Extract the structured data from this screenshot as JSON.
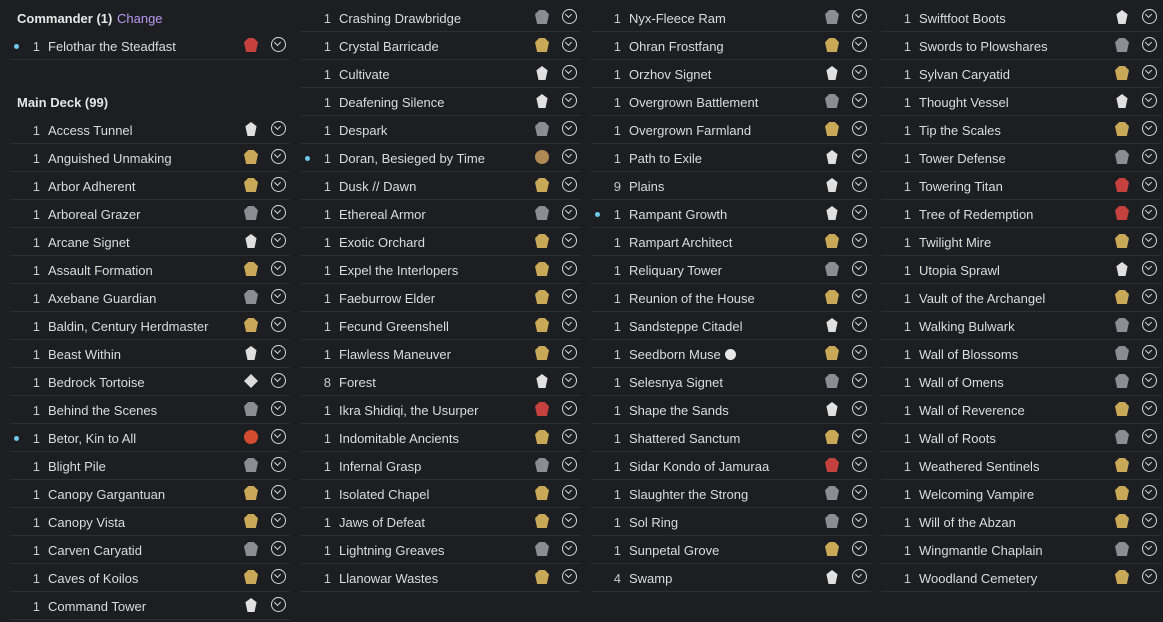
{
  "commander": {
    "header_label": "Commander (1)",
    "change_label": "Change",
    "cards": [
      {
        "qty": "1",
        "name": "Felothar the Steadfast",
        "set_icon": "red",
        "dot": true
      }
    ]
  },
  "main_deck": {
    "header_label": "Main Deck (99)"
  },
  "columns": [
    [
      {
        "qty": "1",
        "name": "Access Tunnel",
        "set_icon": "black"
      },
      {
        "qty": "1",
        "name": "Anguished Unmaking",
        "set_icon": "gold"
      },
      {
        "qty": "1",
        "name": "Arbor Adherent",
        "set_icon": "gold"
      },
      {
        "qty": "1",
        "name": "Arboreal Grazer",
        "set_icon": "silver"
      },
      {
        "qty": "1",
        "name": "Arcane Signet",
        "set_icon": "black"
      },
      {
        "qty": "1",
        "name": "Assault Formation",
        "set_icon": "gold"
      },
      {
        "qty": "1",
        "name": "Axebane Guardian",
        "set_icon": "silver"
      },
      {
        "qty": "1",
        "name": "Baldin, Century Herdmaster",
        "set_icon": "gold"
      },
      {
        "qty": "1",
        "name": "Beast Within",
        "set_icon": "black"
      },
      {
        "qty": "1",
        "name": "Bedrock Tortoise",
        "set_icon": "white"
      },
      {
        "qty": "1",
        "name": "Behind the Scenes",
        "set_icon": "silver"
      },
      {
        "qty": "1",
        "name": "Betor, Kin to All",
        "set_icon": "orange",
        "dot": true
      },
      {
        "qty": "1",
        "name": "Blight Pile",
        "set_icon": "silver"
      },
      {
        "qty": "1",
        "name": "Canopy Gargantuan",
        "set_icon": "gold"
      },
      {
        "qty": "1",
        "name": "Canopy Vista",
        "set_icon": "gold"
      },
      {
        "qty": "1",
        "name": "Carven Caryatid",
        "set_icon": "silver"
      },
      {
        "qty": "1",
        "name": "Caves of Koilos",
        "set_icon": "gold"
      },
      {
        "qty": "1",
        "name": "Command Tower",
        "set_icon": "black"
      }
    ],
    [
      {
        "qty": "1",
        "name": "Crashing Drawbridge",
        "set_icon": "silver"
      },
      {
        "qty": "1",
        "name": "Crystal Barricade",
        "set_icon": "gold"
      },
      {
        "qty": "1",
        "name": "Cultivate",
        "set_icon": "black"
      },
      {
        "qty": "1",
        "name": "Deafening Silence",
        "set_icon": "black"
      },
      {
        "qty": "1",
        "name": "Despark",
        "set_icon": "silver"
      },
      {
        "qty": "1",
        "name": "Doran, Besieged by Time",
        "set_icon": "bronze",
        "dot": true
      },
      {
        "qty": "1",
        "name": "Dusk // Dawn",
        "set_icon": "gold"
      },
      {
        "qty": "1",
        "name": "Ethereal Armor",
        "set_icon": "silver"
      },
      {
        "qty": "1",
        "name": "Exotic Orchard",
        "set_icon": "gold"
      },
      {
        "qty": "1",
        "name": "Expel the Interlopers",
        "set_icon": "gold"
      },
      {
        "qty": "1",
        "name": "Faeburrow Elder",
        "set_icon": "gold"
      },
      {
        "qty": "1",
        "name": "Fecund Greenshell",
        "set_icon": "gold"
      },
      {
        "qty": "1",
        "name": "Flawless Maneuver",
        "set_icon": "gold"
      },
      {
        "qty": "8",
        "name": "Forest",
        "set_icon": "black"
      },
      {
        "qty": "1",
        "name": "Ikra Shidiqi, the Usurper",
        "set_icon": "red"
      },
      {
        "qty": "1",
        "name": "Indomitable Ancients",
        "set_icon": "gold"
      },
      {
        "qty": "1",
        "name": "Infernal Grasp",
        "set_icon": "silver"
      },
      {
        "qty": "1",
        "name": "Isolated Chapel",
        "set_icon": "gold"
      },
      {
        "qty": "1",
        "name": "Jaws of Defeat",
        "set_icon": "gold"
      },
      {
        "qty": "1",
        "name": "Lightning Greaves",
        "set_icon": "silver"
      },
      {
        "qty": "1",
        "name": "Llanowar Wastes",
        "set_icon": "gold"
      }
    ],
    [
      {
        "qty": "1",
        "name": "Nyx-Fleece Ram",
        "set_icon": "silver"
      },
      {
        "qty": "1",
        "name": "Ohran Frostfang",
        "set_icon": "gold"
      },
      {
        "qty": "1",
        "name": "Orzhov Signet",
        "set_icon": "black"
      },
      {
        "qty": "1",
        "name": "Overgrown Battlement",
        "set_icon": "silver"
      },
      {
        "qty": "1",
        "name": "Overgrown Farmland",
        "set_icon": "gold"
      },
      {
        "qty": "1",
        "name": "Path to Exile",
        "set_icon": "black"
      },
      {
        "qty": "9",
        "name": "Plains",
        "set_icon": "black"
      },
      {
        "qty": "1",
        "name": "Rampant Growth",
        "set_icon": "black",
        "dot": true
      },
      {
        "qty": "1",
        "name": "Rampart Architect",
        "set_icon": "gold"
      },
      {
        "qty": "1",
        "name": "Reliquary Tower",
        "set_icon": "silver"
      },
      {
        "qty": "1",
        "name": "Reunion of the House",
        "set_icon": "gold"
      },
      {
        "qty": "1",
        "name": "Sandsteppe Citadel",
        "set_icon": "black"
      },
      {
        "qty": "1",
        "name": "Seedborn Muse",
        "set_icon": "gold",
        "star": true
      },
      {
        "qty": "1",
        "name": "Selesnya Signet",
        "set_icon": "silver"
      },
      {
        "qty": "1",
        "name": "Shape the Sands",
        "set_icon": "black"
      },
      {
        "qty": "1",
        "name": "Shattered Sanctum",
        "set_icon": "gold"
      },
      {
        "qty": "1",
        "name": "Sidar Kondo of Jamuraa",
        "set_icon": "red"
      },
      {
        "qty": "1",
        "name": "Slaughter the Strong",
        "set_icon": "silver"
      },
      {
        "qty": "1",
        "name": "Sol Ring",
        "set_icon": "silver"
      },
      {
        "qty": "1",
        "name": "Sunpetal Grove",
        "set_icon": "gold"
      },
      {
        "qty": "4",
        "name": "Swamp",
        "set_icon": "black"
      }
    ],
    [
      {
        "qty": "1",
        "name": "Swiftfoot Boots",
        "set_icon": "black"
      },
      {
        "qty": "1",
        "name": "Swords to Plowshares",
        "set_icon": "silver"
      },
      {
        "qty": "1",
        "name": "Sylvan Caryatid",
        "set_icon": "gold"
      },
      {
        "qty": "1",
        "name": "Thought Vessel",
        "set_icon": "black"
      },
      {
        "qty": "1",
        "name": "Tip the Scales",
        "set_icon": "gold"
      },
      {
        "qty": "1",
        "name": "Tower Defense",
        "set_icon": "silver"
      },
      {
        "qty": "1",
        "name": "Towering Titan",
        "set_icon": "red"
      },
      {
        "qty": "1",
        "name": "Tree of Redemption",
        "set_icon": "red"
      },
      {
        "qty": "1",
        "name": "Twilight Mire",
        "set_icon": "gold"
      },
      {
        "qty": "1",
        "name": "Utopia Sprawl",
        "set_icon": "black"
      },
      {
        "qty": "1",
        "name": "Vault of the Archangel",
        "set_icon": "gold"
      },
      {
        "qty": "1",
        "name": "Walking Bulwark",
        "set_icon": "silver"
      },
      {
        "qty": "1",
        "name": "Wall of Blossoms",
        "set_icon": "silver"
      },
      {
        "qty": "1",
        "name": "Wall of Omens",
        "set_icon": "silver"
      },
      {
        "qty": "1",
        "name": "Wall of Reverence",
        "set_icon": "gold"
      },
      {
        "qty": "1",
        "name": "Wall of Roots",
        "set_icon": "silver"
      },
      {
        "qty": "1",
        "name": "Weathered Sentinels",
        "set_icon": "gold"
      },
      {
        "qty": "1",
        "name": "Welcoming Vampire",
        "set_icon": "gold"
      },
      {
        "qty": "1",
        "name": "Will of the Abzan",
        "set_icon": "gold"
      },
      {
        "qty": "1",
        "name": "Wingmantle Chaplain",
        "set_icon": "silver"
      },
      {
        "qty": "1",
        "name": "Woodland Cemetery",
        "set_icon": "gold"
      }
    ]
  ],
  "colors": {
    "background": "#1d1e21",
    "divider": "#2e2f33",
    "accent_link": "#b899ef",
    "new_dot": "#6ec9ea"
  },
  "icons": {
    "row_action": "chevron-down-circle-icon",
    "set_symbol": "set-symbol-icon",
    "new_indicator": "dot-indicator-icon"
  }
}
